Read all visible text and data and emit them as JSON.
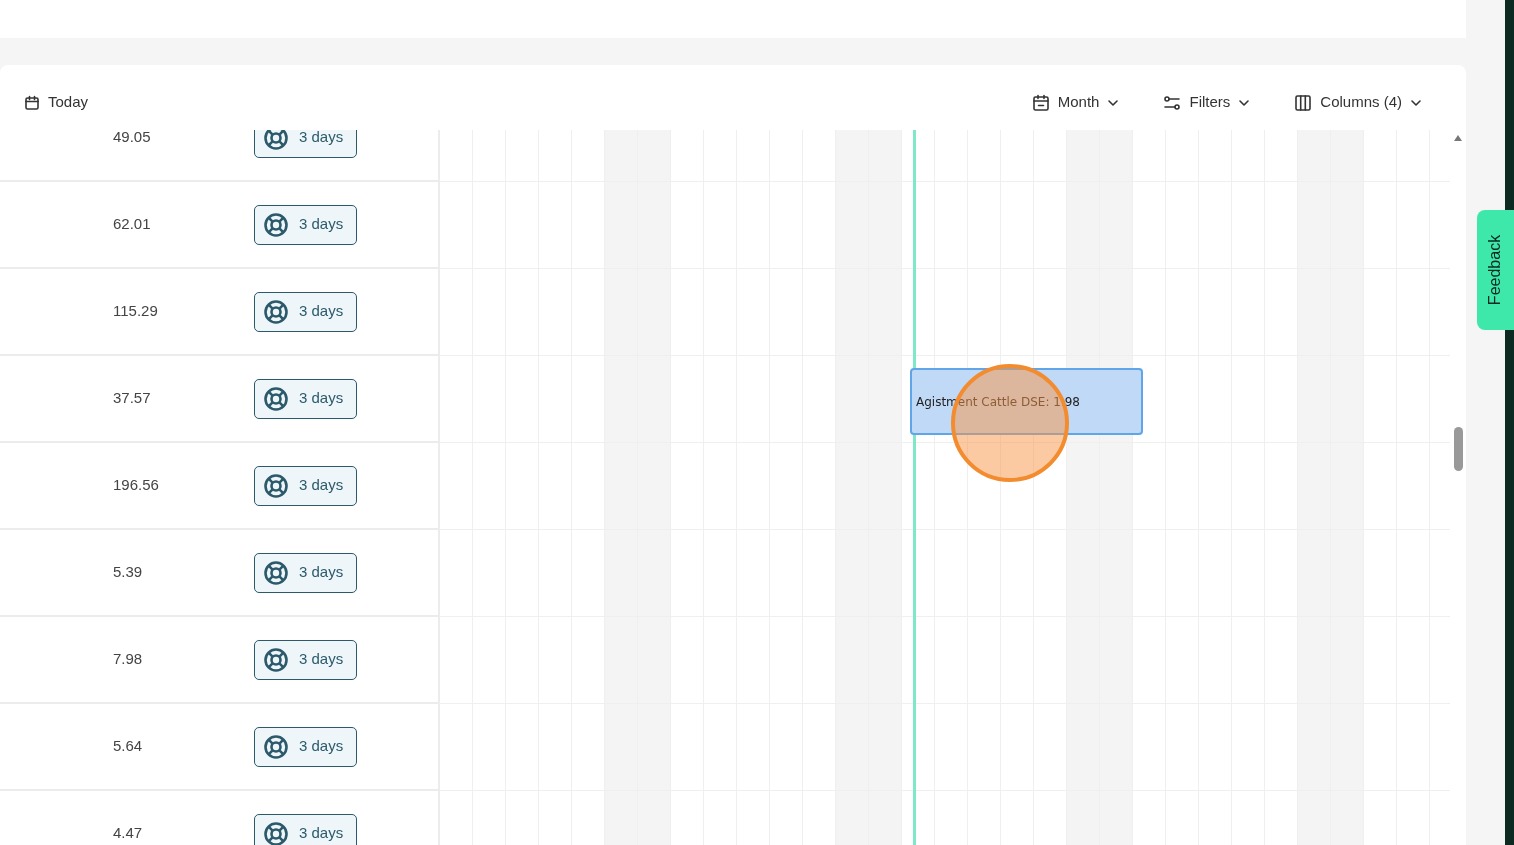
{
  "toolbar": {
    "today": "Today",
    "view": "Month",
    "filters": "Filters",
    "columns": "Columns (4)"
  },
  "rows": [
    {
      "value": "49.05",
      "duration": "3 days"
    },
    {
      "value": "62.01",
      "duration": "3 days"
    },
    {
      "value": "115.29",
      "duration": "3 days"
    },
    {
      "value": "37.57",
      "duration": "3 days",
      "event": {
        "label": "Agistment Cattle DSE: 1.98"
      }
    },
    {
      "value": "196.56",
      "duration": "3 days"
    },
    {
      "value": "5.39",
      "duration": "3 days"
    },
    {
      "value": "7.98",
      "duration": "3 days"
    },
    {
      "value": "5.64",
      "duration": "3 days"
    },
    {
      "value": "4.47",
      "duration": "3 days"
    }
  ],
  "feedback": "Feedback"
}
